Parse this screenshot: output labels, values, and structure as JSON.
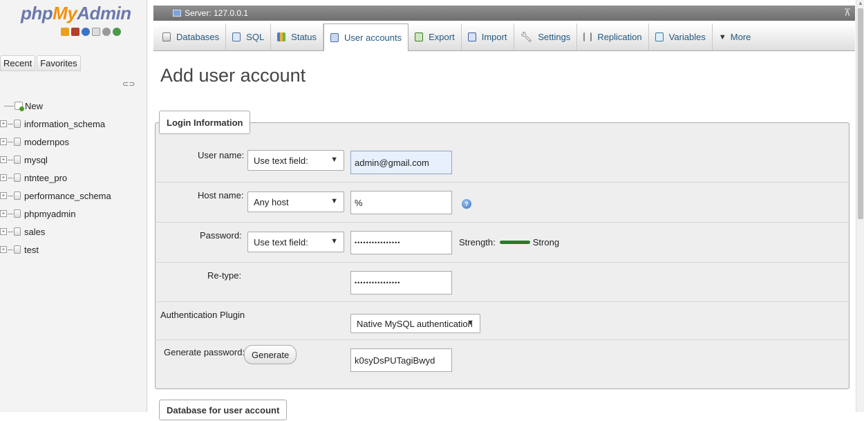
{
  "logo": {
    "php": "php",
    "my": "My",
    "admin": "Admin"
  },
  "nav": {
    "tabs": [
      "Recent",
      "Favorites"
    ],
    "new_label": "New",
    "databases": [
      "information_schema",
      "modernpos",
      "mysql",
      "ntntee_pro",
      "performance_schema",
      "phpmyadmin",
      "sales",
      "test"
    ]
  },
  "server": {
    "title": "Server: 127.0.0.1"
  },
  "tabs": [
    {
      "label": "Databases",
      "icon": "database-icon"
    },
    {
      "label": "SQL",
      "icon": "sql-icon"
    },
    {
      "label": "Status",
      "icon": "status-icon"
    },
    {
      "label": "User accounts",
      "icon": "user-accounts-icon",
      "active": true
    },
    {
      "label": "Export",
      "icon": "export-icon"
    },
    {
      "label": "Import",
      "icon": "import-icon"
    },
    {
      "label": "Settings",
      "icon": "settings-icon"
    },
    {
      "label": "Replication",
      "icon": "replication-icon"
    },
    {
      "label": "Variables",
      "icon": "variables-icon"
    },
    {
      "label": "More",
      "icon": "more-triangle-icon"
    }
  ],
  "page": {
    "title": "Add user account"
  },
  "login": {
    "legend": "Login Information",
    "username_label": "User name:",
    "username_mode": "Use text field:",
    "username_value": "admin@gmail.com",
    "hostname_label": "Host name:",
    "hostname_mode": "Any host",
    "hostname_value": "%",
    "password_label": "Password:",
    "password_mode": "Use text field:",
    "password_value": "••••••••••••••••",
    "strength_label": "Strength:",
    "strength_value": "Strong",
    "retype_label": "Re-type:",
    "retype_value": "••••••••••••••••",
    "auth_label": "Authentication Plugin",
    "auth_value": "Native MySQL authentication",
    "generate_label": "Generate password:",
    "generate_button": "Generate",
    "generated_value": "k0syDsPUTagiBwyd"
  },
  "next_section": {
    "legend": "Database for user account"
  },
  "colors": {
    "accent": "#235a81",
    "strength": "#2a7a2a",
    "logo_blue": "#6c78af",
    "logo_orange": "#f29111"
  }
}
